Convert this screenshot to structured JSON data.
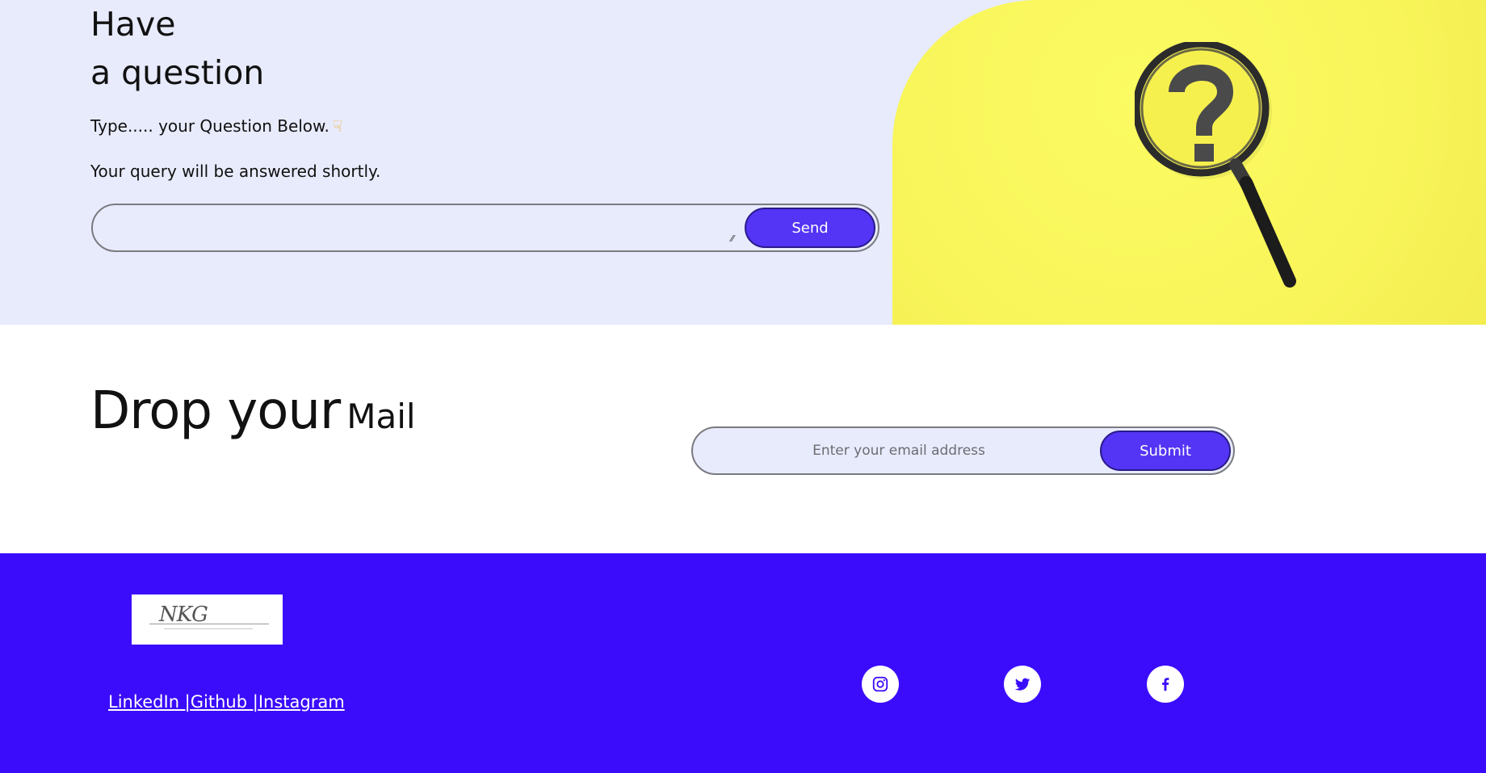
{
  "question": {
    "heading_line1": "Have",
    "heading_line2": "a question",
    "prompt": "Type..... your Question Below.",
    "pointer_icon": "pointing-down-hand",
    "note": "Your query will be answered shortly.",
    "textarea_value": "",
    "send_label": "Send",
    "image_icon": "magnifier-question-icon"
  },
  "mail": {
    "heading_main": "Drop your",
    "heading_small": "Mail",
    "email_placeholder": "Enter your email address",
    "submit_label": "Submit"
  },
  "footer": {
    "logo_text": "NKG",
    "links": {
      "linkedin": "LinkedIn |",
      "github": "Github |",
      "instagram": "Instagram"
    },
    "social": [
      {
        "icon": "instagram-icon"
      },
      {
        "icon": "twitter-icon"
      },
      {
        "icon": "facebook-icon"
      }
    ]
  },
  "colors": {
    "accent": "#5434f5",
    "footer_bg": "#3b0cfb",
    "section_bg": "#e8ebfc",
    "yellow": "#f8f55a"
  }
}
